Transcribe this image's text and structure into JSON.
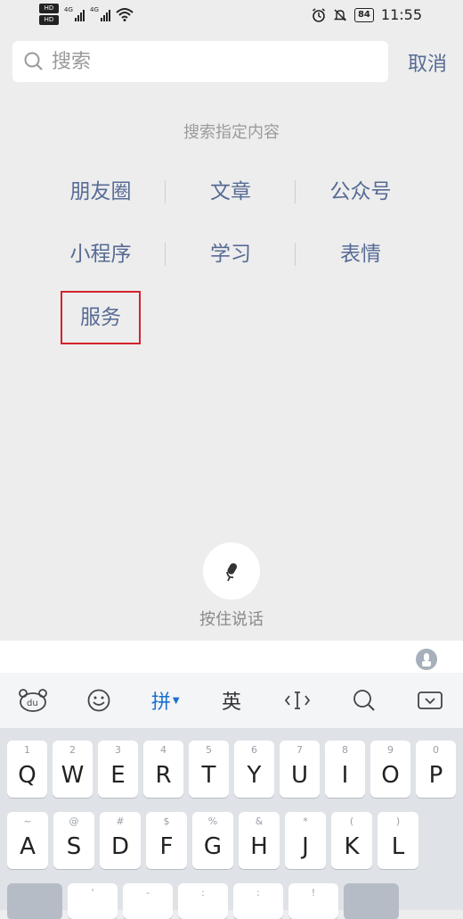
{
  "status_bar": {
    "hd_badges": [
      "HD",
      "HD"
    ],
    "network_labels": [
      "4G",
      "4G"
    ],
    "battery": "84",
    "time": "11:55"
  },
  "search": {
    "placeholder": "搜索",
    "value": "",
    "cancel_label": "取消"
  },
  "hint": "搜索指定内容",
  "categories": [
    [
      "朋友圈",
      "文章",
      "公众号"
    ],
    [
      "小程序",
      "学习",
      "表情"
    ],
    [
      "服务"
    ]
  ],
  "voice": {
    "label": "按住说话"
  },
  "keyboard": {
    "toolbar": {
      "pinyin_label": "拼",
      "english_label": "英"
    },
    "row1": [
      {
        "sup": "1",
        "key": "Q"
      },
      {
        "sup": "2",
        "key": "W"
      },
      {
        "sup": "3",
        "key": "E"
      },
      {
        "sup": "4",
        "key": "R"
      },
      {
        "sup": "5",
        "key": "T"
      },
      {
        "sup": "6",
        "key": "Y"
      },
      {
        "sup": "7",
        "key": "U"
      },
      {
        "sup": "8",
        "key": "I"
      },
      {
        "sup": "9",
        "key": "O"
      },
      {
        "sup": "0",
        "key": "P"
      }
    ],
    "row2": [
      {
        "sup": "~",
        "key": "A"
      },
      {
        "sup": "@",
        "key": "S"
      },
      {
        "sup": "#",
        "key": "D"
      },
      {
        "sup": "$",
        "key": "F"
      },
      {
        "sup": "%",
        "key": "G"
      },
      {
        "sup": "&",
        "key": "H"
      },
      {
        "sup": "*",
        "key": "J"
      },
      {
        "sup": "(",
        "key": "K"
      },
      {
        "sup": ")",
        "key": "L"
      }
    ],
    "row3_sups": [
      "'",
      "-",
      ":",
      ":",
      "!"
    ]
  },
  "colors": {
    "link": "#576b95",
    "highlight_box": "#d4232b",
    "background": "#ededed"
  }
}
